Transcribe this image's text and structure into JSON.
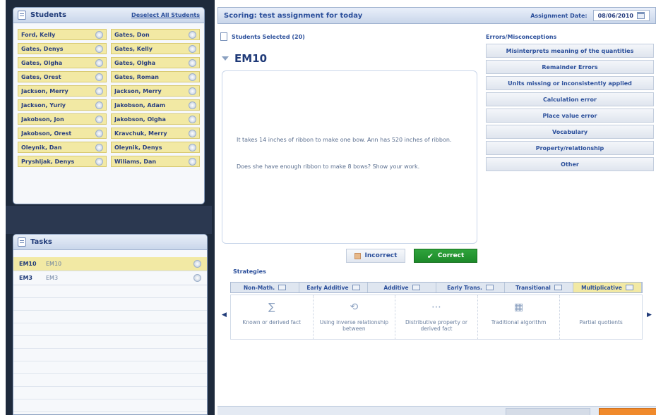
{
  "students_panel": {
    "title": "Students",
    "deselect_label": "Deselect All Students",
    "students": [
      "Ford, Kelly",
      "Gates, Don",
      "Gates, Denys",
      "Gates, Kelly",
      "Gates, Olgha",
      "Gates, Olgha",
      "Gates, Orest",
      "Gates, Roman",
      "Jackson, Merry",
      "Jackson, Merry",
      "Jackson, Yuriy",
      "Jakobson, Adam",
      "Jakobson, Jon",
      "Jakobson, Olgha",
      "Jakobson, Orest",
      "Kravchuk, Merry",
      "Oleynik, Dan",
      "Oleynik, Denys",
      "Pryshljak, Denys",
      "Wiliams, Dan"
    ]
  },
  "tasks_panel": {
    "title": "Tasks",
    "tasks": [
      {
        "code": "EM10",
        "name": "EM10"
      },
      {
        "code": "EM3",
        "name": "EM3"
      }
    ]
  },
  "header": {
    "title": "Scoring: test assignment for today",
    "date_label": "Assignment Date:",
    "date_value": "08/06/2010"
  },
  "selection": {
    "students_selected": "Students Selected (20)"
  },
  "question": {
    "code": "EM10",
    "text": "It takes 14 inches of ribbon to make one bow. Ann has 520 inches of ribbon.",
    "ask": "Does she have enough ribbon to make 8 bows? Show your work."
  },
  "errors": {
    "title": "Errors/Misconceptions",
    "items": [
      "Misinterprets meaning of the quantities",
      "Remainder Errors",
      "Units missing or inconsistently applied",
      "Calculation error",
      "Place value error",
      "Vocabulary",
      "Property/relationship",
      "Other"
    ]
  },
  "scoring": {
    "incorrect_label": "Incorrect",
    "correct_label": "Correct"
  },
  "strategies": {
    "title": "Strategies",
    "tabs": [
      "Non-Math.",
      "Early Additive",
      "Additive",
      "Early Trans.",
      "Transitional",
      "Multiplicative"
    ],
    "active_tab": "Multiplicative",
    "cards": [
      {
        "label": "Known or derived fact",
        "icon": "sum-icon"
      },
      {
        "label": "Using inverse relationship between",
        "icon": "cycle-arrows-icon"
      },
      {
        "label": "Distributive property or derived fact",
        "icon": "distributive-icon"
      },
      {
        "label": "Traditional algorithm",
        "icon": "algorithm-icon"
      },
      {
        "label": "Partial quotients",
        "icon": "partial-quotients-icon"
      }
    ]
  },
  "colors": {
    "accent": "#2b4f9b",
    "correct_green": "#2fa33c",
    "selected_yellow": "#f2e9a4",
    "footer_orange": "#f08a2c"
  }
}
